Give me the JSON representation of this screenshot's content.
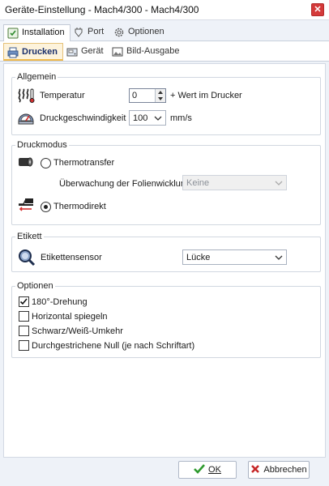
{
  "window": {
    "title": "Geräte-Einstellung -   Mach4/300   - Mach4/300",
    "close_label": "✕"
  },
  "top_tabs": [
    {
      "label": "Installation",
      "icon": "installation-icon",
      "active": true
    },
    {
      "label": "Port",
      "icon": "port-icon",
      "active": false
    },
    {
      "label": "Optionen",
      "icon": "gear-icon",
      "active": false
    }
  ],
  "sub_tabs": [
    {
      "label": "Drucken",
      "icon": "printer-icon",
      "active": true
    },
    {
      "label": "Gerät",
      "icon": "device-icon",
      "active": false
    },
    {
      "label": "Bild-Ausgabe",
      "icon": "image-icon",
      "active": false
    }
  ],
  "allgemein": {
    "legend": "Allgemein",
    "temperature_label": "Temperatur",
    "temperature_value": "0",
    "temperature_suffix": "+ Wert im Drucker",
    "speed_label": "Druckgeschwindigkeit",
    "speed_value": "100",
    "speed_unit": "mm/s"
  },
  "druckmodus": {
    "legend": "Druckmodus",
    "thermotransfer_label": "Thermotransfer",
    "thermotransfer_selected": false,
    "foil_label": "Überwachung der Folienwicklung",
    "foil_value": "Keine",
    "thermodirekt_label": "Thermodirekt",
    "thermodirekt_selected": true
  },
  "etikett": {
    "legend": "Etikett",
    "sensor_label": "Etikettensensor",
    "sensor_value": "Lücke"
  },
  "optionen": {
    "legend": "Optionen",
    "items": [
      {
        "label": "180°-Drehung",
        "checked": true
      },
      {
        "label": "Horizontal spiegeln",
        "checked": false
      },
      {
        "label": "Schwarz/Weiß-Umkehr",
        "checked": false
      },
      {
        "label": "Durchgestrichene Null (je nach Schriftart)",
        "checked": false
      }
    ]
  },
  "footer": {
    "ok_label": "OK",
    "cancel_label": "Abbrechen"
  },
  "colors": {
    "background": "#eef2f8",
    "active_subtab": "#fdf3dc",
    "ok_check": "#2e9a2e",
    "cancel_x": "#c62828"
  }
}
